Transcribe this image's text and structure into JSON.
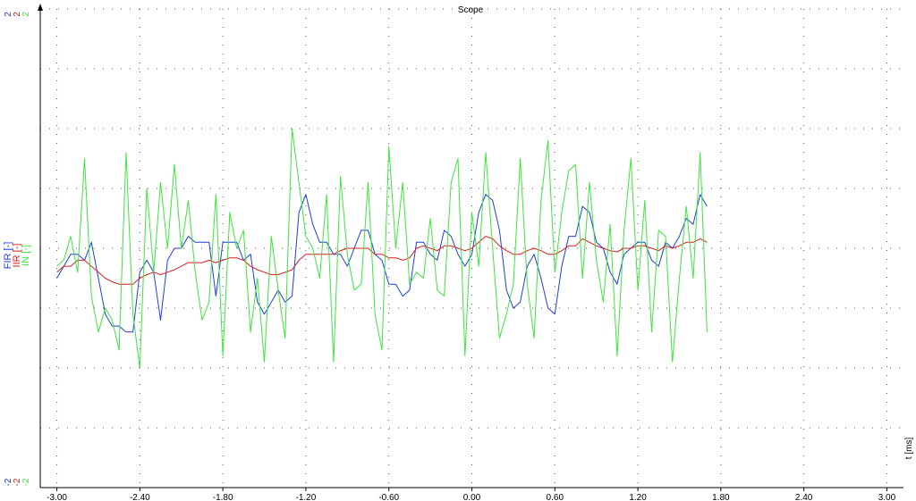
{
  "chart_data": {
    "type": "line",
    "title": "Scope",
    "xlabel": "t [ms]",
    "xlim": [
      -3.12,
      3.12
    ],
    "ylim": [
      -2,
      2
    ],
    "x_ticks": [
      "-3.00",
      "-2.40",
      "-1.80",
      "-1.20",
      "-0.60",
      "0.00",
      "0.60",
      "1.20",
      "1.80",
      "2.40",
      "3.00"
    ],
    "grid": true,
    "series": [
      {
        "name": "FIR [-]",
        "color": "#1f3fd6",
        "axis_max_label": "2",
        "axis_min_label": "-2",
        "x_start": -3.0,
        "x_step": 0.05,
        "values": [
          -0.25,
          -0.15,
          -0.05,
          -0.05,
          -0.1,
          0.05,
          -0.25,
          -0.55,
          -0.65,
          -0.65,
          -0.7,
          -0.7,
          -0.2,
          -0.1,
          -0.2,
          -0.6,
          -0.1,
          0.0,
          0.0,
          0.1,
          0.05,
          0.05,
          0.05,
          -0.4,
          0.05,
          0.05,
          0.05,
          -0.1,
          -0.05,
          -0.45,
          -0.55,
          -0.45,
          -0.35,
          -0.45,
          -0.4,
          0.3,
          0.45,
          0.2,
          0.05,
          0.05,
          -0.05,
          -0.05,
          -0.15,
          0.0,
          0.15,
          0.15,
          -0.05,
          -0.1,
          -0.3,
          -0.3,
          -0.4,
          -0.35,
          0.05,
          0.05,
          -0.05,
          -0.1,
          0.15,
          0.1,
          -0.05,
          -0.15,
          -0.05,
          0.3,
          0.45,
          0.4,
          0.15,
          -0.35,
          -0.5,
          -0.45,
          -0.15,
          -0.05,
          -0.25,
          -0.5,
          -0.55,
          -0.15,
          0.1,
          0.1,
          0.35,
          0.3,
          0.05,
          0.0,
          -0.2,
          -0.3,
          -0.05,
          0.0,
          0.05,
          0.05,
          -0.1,
          -0.15,
          0.05,
          0.0,
          0.1,
          0.25,
          0.2,
          0.45,
          0.35
        ]
      },
      {
        "name": "IIR [-]",
        "color": "#d81e1e",
        "axis_max_label": "2",
        "axis_min_label": "-2",
        "x_start": -3.0,
        "x_step": 0.05,
        "values": [
          -0.2,
          -0.15,
          -0.15,
          -0.1,
          -0.1,
          -0.15,
          -0.2,
          -0.25,
          -0.28,
          -0.3,
          -0.3,
          -0.3,
          -0.25,
          -0.22,
          -0.2,
          -0.22,
          -0.2,
          -0.18,
          -0.15,
          -0.12,
          -0.12,
          -0.12,
          -0.1,
          -0.12,
          -0.1,
          -0.08,
          -0.08,
          -0.1,
          -0.15,
          -0.18,
          -0.2,
          -0.22,
          -0.22,
          -0.2,
          -0.18,
          -0.1,
          -0.05,
          -0.05,
          -0.05,
          -0.05,
          -0.05,
          -0.02,
          0.0,
          0.0,
          0.0,
          0.0,
          -0.05,
          -0.05,
          -0.08,
          -0.08,
          -0.1,
          -0.08,
          0.0,
          0.02,
          0.0,
          -0.02,
          0.02,
          0.02,
          0.0,
          -0.02,
          0.0,
          0.05,
          0.1,
          0.08,
          0.02,
          -0.02,
          -0.05,
          -0.05,
          -0.02,
          0.0,
          -0.02,
          -0.05,
          -0.05,
          -0.02,
          0.02,
          0.02,
          0.08,
          0.05,
          0.02,
          0.0,
          -0.02,
          -0.03,
          0.0,
          0.0,
          0.02,
          0.02,
          0.0,
          -0.02,
          0.02,
          0.0,
          0.02,
          0.05,
          0.05,
          0.08,
          0.05
        ]
      },
      {
        "name": "IN [-]",
        "color": "#3ce63c",
        "axis_max_label": "2",
        "axis_min_label": "-2",
        "x_start": -3.0,
        "x_step": 0.05,
        "values": [
          -0.15,
          -0.1,
          0.1,
          -0.2,
          0.75,
          -0.4,
          -0.7,
          -0.5,
          -0.6,
          -0.85,
          0.8,
          -0.55,
          -1.0,
          0.5,
          -0.2,
          0.55,
          0.0,
          0.7,
          0.0,
          0.4,
          -0.2,
          -0.6,
          -0.45,
          0.45,
          -0.9,
          0.3,
          0.0,
          0.15,
          -0.7,
          -0.25,
          -0.95,
          0.1,
          -0.35,
          -0.75,
          1.0,
          0.55,
          0.1,
          0.0,
          -0.25,
          0.45,
          -0.95,
          0.6,
          -0.05,
          -0.35,
          -0.3,
          0.55,
          -0.55,
          -0.85,
          0.85,
          0.0,
          0.55,
          -0.3,
          -0.2,
          -0.25,
          0.25,
          -0.35,
          -0.4,
          0.55,
          0.75,
          -0.9,
          0.3,
          -0.15,
          0.8,
          0.0,
          -0.75,
          -0.55,
          -0.3,
          0.75,
          -0.3,
          -0.75,
          0.4,
          0.9,
          -0.2,
          0.3,
          0.65,
          0.7,
          -0.25,
          0.55,
          -0.1,
          -0.45,
          0.2,
          -0.9,
          0.15,
          0.75,
          -0.35,
          0.4,
          -0.7,
          0.15,
          0.1,
          -0.95,
          -0.25,
          0.35,
          -0.25,
          0.8,
          -0.7
        ]
      }
    ]
  }
}
